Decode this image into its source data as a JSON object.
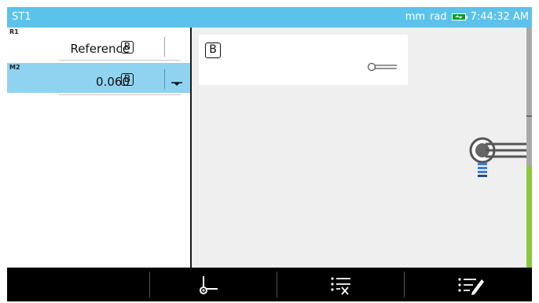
{
  "titlebar": {
    "title": "ST1",
    "units": "mm",
    "angle_units": "rad",
    "time": "7:44:32 AM",
    "bg_color": "#5bc3eb",
    "battery_icon": "battery-charging-icon"
  },
  "readings": [
    {
      "id": "R1",
      "value": "Reference",
      "badge": "B",
      "selected": false
    },
    {
      "id": "M2",
      "value": "0.060",
      "badge": "B",
      "selected": true,
      "icon": "tolerance-dropdown-icon"
    }
  ],
  "preview": {
    "badge": "B",
    "probe_icon": "probe-icon",
    "tool_icon": "probe-tool-icon"
  },
  "scale": {
    "color_ok": "#8cc63f"
  },
  "toolbar": {
    "buttons": [
      {
        "name": "empty",
        "icon": ""
      },
      {
        "name": "origin",
        "icon": "origin-axis-icon"
      },
      {
        "name": "clear-list",
        "icon": "list-clear-icon"
      },
      {
        "name": "edit-list",
        "icon": "list-edit-icon"
      }
    ]
  }
}
